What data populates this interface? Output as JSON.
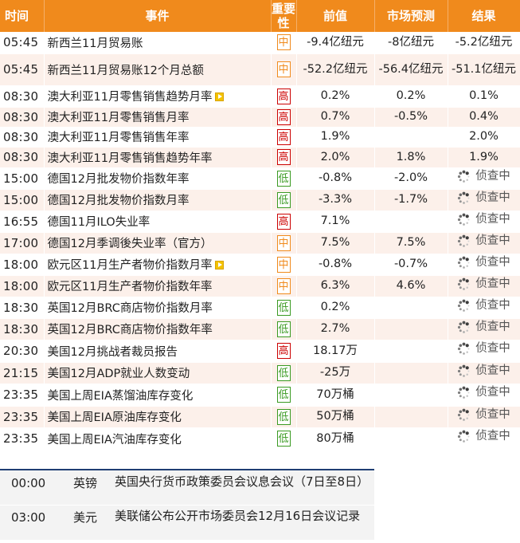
{
  "header": {
    "time": "时间",
    "event": "事件",
    "importance": "重要性",
    "previous": "前值",
    "forecast": "市场预测",
    "result": "结果"
  },
  "rows": [
    {
      "time": "05:45",
      "event": "新西兰11月贸易账",
      "imp": "中",
      "level": "mid",
      "video": false,
      "previous": "-9.4亿纽元",
      "forecast": "-8亿纽元",
      "result": "-5.2亿纽元",
      "pending": false
    },
    {
      "time": "05:45",
      "event": "新西兰11月贸易账12个月总额",
      "imp": "中",
      "level": "mid",
      "video": false,
      "previous": "-52.2亿纽元",
      "forecast": "-56.4亿纽元",
      "result": "-51.1亿纽元",
      "pending": false
    },
    {
      "time": "08:30",
      "event": "澳大利亚11月零售销售趋势月率",
      "imp": "高",
      "level": "high",
      "video": true,
      "previous": "0.2%",
      "forecast": "0.2%",
      "result": "0.1%",
      "pending": false
    },
    {
      "time": "08:30",
      "event": "澳大利亚11月零售销售月率",
      "imp": "高",
      "level": "high",
      "video": false,
      "previous": "0.7%",
      "forecast": "-0.5%",
      "result": "0.4%",
      "pending": false
    },
    {
      "time": "08:30",
      "event": "澳大利亚11月零售销售年率",
      "imp": "高",
      "level": "high",
      "video": false,
      "previous": "1.9%",
      "forecast": "",
      "result": "2.0%",
      "pending": false
    },
    {
      "time": "08:30",
      "event": "澳大利亚11月零售销售趋势年率",
      "imp": "高",
      "level": "high",
      "video": false,
      "previous": "2.0%",
      "forecast": "1.8%",
      "result": "1.9%",
      "pending": false
    },
    {
      "time": "15:00",
      "event": "德国12月批发物价指数年率",
      "imp": "低",
      "level": "low",
      "video": false,
      "previous": "-0.8%",
      "forecast": "-2.0%",
      "result": "侦查中",
      "pending": true
    },
    {
      "time": "15:00",
      "event": "德国12月批发物价指数月率",
      "imp": "低",
      "level": "low",
      "video": false,
      "previous": "-3.3%",
      "forecast": "-1.7%",
      "result": "侦查中",
      "pending": true
    },
    {
      "time": "16:55",
      "event": "德国11月ILO失业率",
      "imp": "高",
      "level": "high",
      "video": false,
      "previous": "7.1%",
      "forecast": "",
      "result": "侦查中",
      "pending": true
    },
    {
      "time": "17:00",
      "event": "德国12月季调後失业率（官方）",
      "imp": "中",
      "level": "mid",
      "video": false,
      "previous": "7.5%",
      "forecast": "7.5%",
      "result": "侦查中",
      "pending": true
    },
    {
      "time": "18:00",
      "event": "欧元区11月生产者物价指数月率",
      "imp": "中",
      "level": "mid",
      "video": true,
      "previous": "-0.8%",
      "forecast": "-0.7%",
      "result": "侦查中",
      "pending": true
    },
    {
      "time": "18:00",
      "event": "欧元区11月生产者物价指数年率",
      "imp": "中",
      "level": "mid",
      "video": false,
      "previous": "6.3%",
      "forecast": "4.6%",
      "result": "侦查中",
      "pending": true
    },
    {
      "time": "18:30",
      "event": "英国12月BRC商店物价指数月率",
      "imp": "低",
      "level": "low",
      "video": false,
      "previous": "0.2%",
      "forecast": "",
      "result": "侦查中",
      "pending": true
    },
    {
      "time": "18:30",
      "event": "英国12月BRC商店物价指数年率",
      "imp": "低",
      "level": "low",
      "video": false,
      "previous": "2.7%",
      "forecast": "",
      "result": "侦查中",
      "pending": true
    },
    {
      "time": "20:30",
      "event": "美国12月挑战者裁员报告",
      "imp": "高",
      "level": "high",
      "video": false,
      "previous": "18.17万",
      "forecast": "",
      "result": "侦查中",
      "pending": true
    },
    {
      "time": "21:15",
      "event": "美国12月ADP就业人数变动",
      "imp": "低",
      "level": "low",
      "video": false,
      "previous": "-25万",
      "forecast": "",
      "result": "侦查中",
      "pending": true
    },
    {
      "time": "23:35",
      "event": "美国上周EIA蒸馏油库存变化",
      "imp": "低",
      "level": "low",
      "video": false,
      "previous": "70万桶",
      "forecast": "",
      "result": "侦查中",
      "pending": true
    },
    {
      "time": "23:35",
      "event": "美国上周EIA原油库存变化",
      "imp": "低",
      "level": "low",
      "video": false,
      "previous": "50万桶",
      "forecast": "",
      "result": "侦查中",
      "pending": true
    },
    {
      "time": "23:35",
      "event": "美国上周EIA汽油库存变化",
      "imp": "低",
      "level": "low",
      "video": false,
      "previous": "80万桶",
      "forecast": "",
      "result": "侦查中",
      "pending": true
    }
  ],
  "events": [
    {
      "time": "00:00",
      "currency": "英镑",
      "text": "英国央行货币政策委员会议息会议（7日至8日）"
    },
    {
      "time": "03:00",
      "currency": "美元",
      "text": "美联储公布公开市场委员会12月16日会议记录"
    }
  ],
  "colors": {
    "header": "#f08a1c",
    "high": "#cc0000",
    "mid": "#f08a1c",
    "low": "#3a9a22",
    "stripe": "#fcf0ea",
    "event_border": "#1f3e73"
  }
}
